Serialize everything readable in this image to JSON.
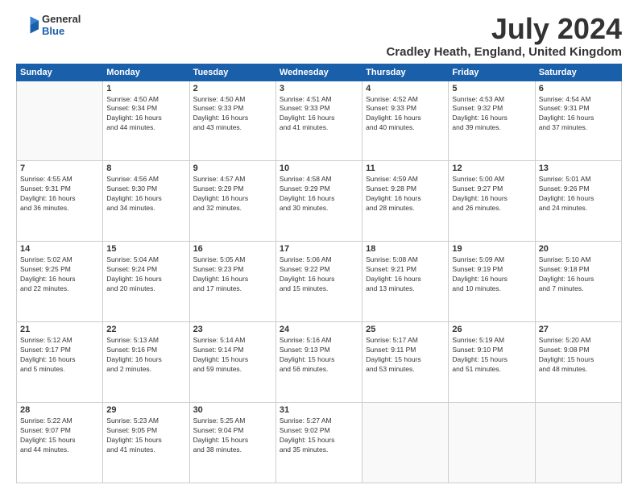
{
  "header": {
    "logo_line1": "General",
    "logo_line2": "Blue",
    "main_title": "July 2024",
    "subtitle": "Cradley Heath, England, United Kingdom"
  },
  "calendar": {
    "headers": [
      "Sunday",
      "Monday",
      "Tuesday",
      "Wednesday",
      "Thursday",
      "Friday",
      "Saturday"
    ],
    "weeks": [
      [
        {
          "day": "",
          "info": ""
        },
        {
          "day": "1",
          "info": "Sunrise: 4:50 AM\nSunset: 9:34 PM\nDaylight: 16 hours\nand 44 minutes."
        },
        {
          "day": "2",
          "info": "Sunrise: 4:50 AM\nSunset: 9:33 PM\nDaylight: 16 hours\nand 43 minutes."
        },
        {
          "day": "3",
          "info": "Sunrise: 4:51 AM\nSunset: 9:33 PM\nDaylight: 16 hours\nand 41 minutes."
        },
        {
          "day": "4",
          "info": "Sunrise: 4:52 AM\nSunset: 9:33 PM\nDaylight: 16 hours\nand 40 minutes."
        },
        {
          "day": "5",
          "info": "Sunrise: 4:53 AM\nSunset: 9:32 PM\nDaylight: 16 hours\nand 39 minutes."
        },
        {
          "day": "6",
          "info": "Sunrise: 4:54 AM\nSunset: 9:31 PM\nDaylight: 16 hours\nand 37 minutes."
        }
      ],
      [
        {
          "day": "7",
          "info": "Sunrise: 4:55 AM\nSunset: 9:31 PM\nDaylight: 16 hours\nand 36 minutes."
        },
        {
          "day": "8",
          "info": "Sunrise: 4:56 AM\nSunset: 9:30 PM\nDaylight: 16 hours\nand 34 minutes."
        },
        {
          "day": "9",
          "info": "Sunrise: 4:57 AM\nSunset: 9:29 PM\nDaylight: 16 hours\nand 32 minutes."
        },
        {
          "day": "10",
          "info": "Sunrise: 4:58 AM\nSunset: 9:29 PM\nDaylight: 16 hours\nand 30 minutes."
        },
        {
          "day": "11",
          "info": "Sunrise: 4:59 AM\nSunset: 9:28 PM\nDaylight: 16 hours\nand 28 minutes."
        },
        {
          "day": "12",
          "info": "Sunrise: 5:00 AM\nSunset: 9:27 PM\nDaylight: 16 hours\nand 26 minutes."
        },
        {
          "day": "13",
          "info": "Sunrise: 5:01 AM\nSunset: 9:26 PM\nDaylight: 16 hours\nand 24 minutes."
        }
      ],
      [
        {
          "day": "14",
          "info": "Sunrise: 5:02 AM\nSunset: 9:25 PM\nDaylight: 16 hours\nand 22 minutes."
        },
        {
          "day": "15",
          "info": "Sunrise: 5:04 AM\nSunset: 9:24 PM\nDaylight: 16 hours\nand 20 minutes."
        },
        {
          "day": "16",
          "info": "Sunrise: 5:05 AM\nSunset: 9:23 PM\nDaylight: 16 hours\nand 17 minutes."
        },
        {
          "day": "17",
          "info": "Sunrise: 5:06 AM\nSunset: 9:22 PM\nDaylight: 16 hours\nand 15 minutes."
        },
        {
          "day": "18",
          "info": "Sunrise: 5:08 AM\nSunset: 9:21 PM\nDaylight: 16 hours\nand 13 minutes."
        },
        {
          "day": "19",
          "info": "Sunrise: 5:09 AM\nSunset: 9:19 PM\nDaylight: 16 hours\nand 10 minutes."
        },
        {
          "day": "20",
          "info": "Sunrise: 5:10 AM\nSunset: 9:18 PM\nDaylight: 16 hours\nand 7 minutes."
        }
      ],
      [
        {
          "day": "21",
          "info": "Sunrise: 5:12 AM\nSunset: 9:17 PM\nDaylight: 16 hours\nand 5 minutes."
        },
        {
          "day": "22",
          "info": "Sunrise: 5:13 AM\nSunset: 9:16 PM\nDaylight: 16 hours\nand 2 minutes."
        },
        {
          "day": "23",
          "info": "Sunrise: 5:14 AM\nSunset: 9:14 PM\nDaylight: 15 hours\nand 59 minutes."
        },
        {
          "day": "24",
          "info": "Sunrise: 5:16 AM\nSunset: 9:13 PM\nDaylight: 15 hours\nand 56 minutes."
        },
        {
          "day": "25",
          "info": "Sunrise: 5:17 AM\nSunset: 9:11 PM\nDaylight: 15 hours\nand 53 minutes."
        },
        {
          "day": "26",
          "info": "Sunrise: 5:19 AM\nSunset: 9:10 PM\nDaylight: 15 hours\nand 51 minutes."
        },
        {
          "day": "27",
          "info": "Sunrise: 5:20 AM\nSunset: 9:08 PM\nDaylight: 15 hours\nand 48 minutes."
        }
      ],
      [
        {
          "day": "28",
          "info": "Sunrise: 5:22 AM\nSunset: 9:07 PM\nDaylight: 15 hours\nand 44 minutes."
        },
        {
          "day": "29",
          "info": "Sunrise: 5:23 AM\nSunset: 9:05 PM\nDaylight: 15 hours\nand 41 minutes."
        },
        {
          "day": "30",
          "info": "Sunrise: 5:25 AM\nSunset: 9:04 PM\nDaylight: 15 hours\nand 38 minutes."
        },
        {
          "day": "31",
          "info": "Sunrise: 5:27 AM\nSunset: 9:02 PM\nDaylight: 15 hours\nand 35 minutes."
        },
        {
          "day": "",
          "info": ""
        },
        {
          "day": "",
          "info": ""
        },
        {
          "day": "",
          "info": ""
        }
      ]
    ]
  }
}
